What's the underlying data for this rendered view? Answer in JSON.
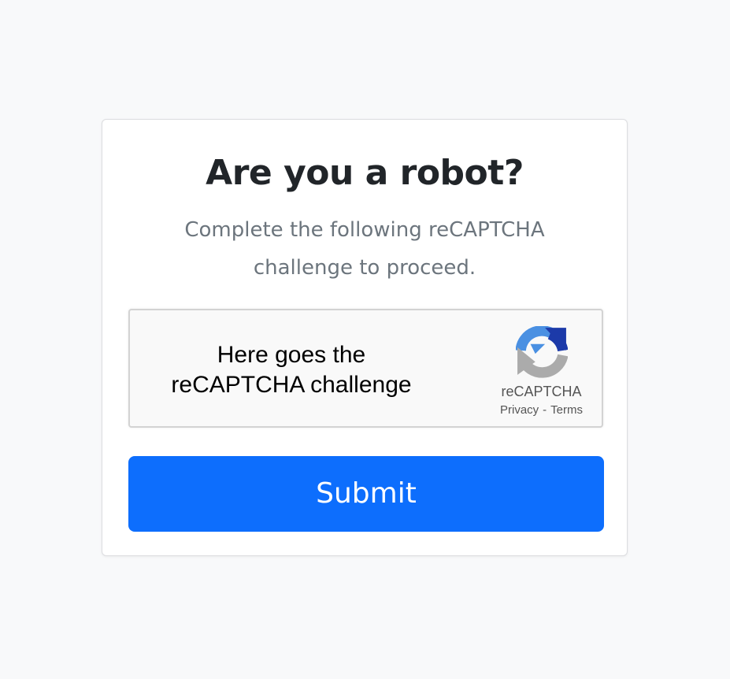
{
  "card": {
    "title": "Are you a robot?",
    "subtitle": "Complete the following reCAPTCHA challenge to proceed."
  },
  "recaptcha": {
    "placeholder_line1": "Here goes the",
    "placeholder_line2": "reCAPTCHA challenge",
    "brand": "reCAPTCHA",
    "privacy_link": "Privacy",
    "separator": "-",
    "terms_link": "Terms",
    "logo_icon": "recaptcha-logo-icon"
  },
  "form": {
    "submit_label": "Submit"
  },
  "colors": {
    "page_background": "#f8f9fa",
    "title": "#212529",
    "subtitle": "#6c757d",
    "primary": "#0d6efd",
    "recaptcha_blue": "#4a90e2",
    "recaptcha_dark_blue": "#1c3aa9",
    "recaptcha_gray": "#ababab"
  }
}
